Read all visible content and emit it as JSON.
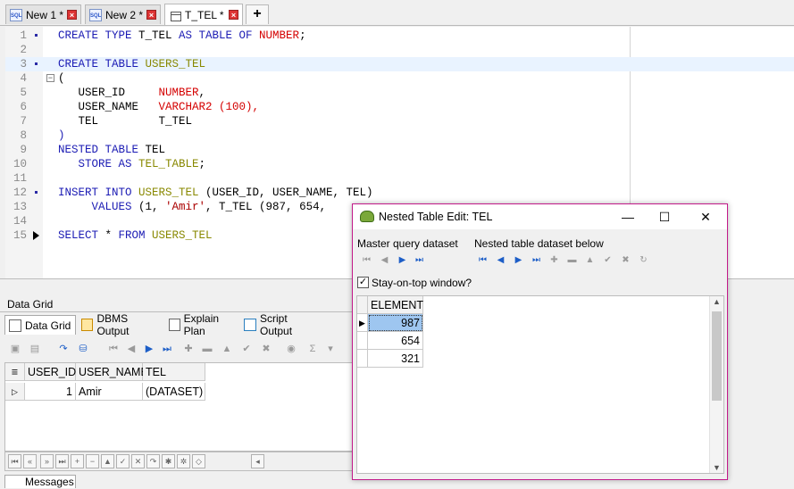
{
  "tabs": [
    {
      "label": "New 1 *"
    },
    {
      "label": "New 2 *"
    },
    {
      "label": "T_TEL *"
    }
  ],
  "tab_add": "+",
  "editor": {
    "lines": [
      {
        "num": "1"
      },
      {
        "num": "2"
      },
      {
        "num": "3"
      },
      {
        "num": "4"
      },
      {
        "num": "5"
      },
      {
        "num": "6"
      },
      {
        "num": "7"
      },
      {
        "num": "8"
      },
      {
        "num": "9"
      },
      {
        "num": "10"
      },
      {
        "num": "11"
      },
      {
        "num": "12"
      },
      {
        "num": "13"
      },
      {
        "num": "14"
      },
      {
        "num": "15"
      }
    ],
    "tokens": {
      "l1a": "CREATE TYPE",
      "l1b": " T_TEL ",
      "l1c": "AS TABLE OF",
      "l1d": " NUMBER",
      "l1e": ";",
      "l3a": "CREATE TABLE",
      "l3b": " USERS_TEL",
      "l4": "(",
      "l5a": "   USER_ID     ",
      "l5b": "NUMBER",
      "l5c": ",",
      "l6a": "   USER_NAME   ",
      "l6b": "VARCHAR2",
      "l6c": " (100),",
      "l7": "   TEL         T_TEL",
      "l8": ")",
      "l9a": "NESTED TABLE",
      "l9b": " TEL",
      "l10a": "   STORE AS",
      "l10b": " TEL_TABLE",
      "l10c": ";",
      "l12a": "INSERT INTO",
      "l12b": " USERS_TEL",
      "l12c": " (USER_ID, USER_NAME, TEL)",
      "l13a": "     VALUES",
      "l13b": " (1, ",
      "l13c": "'Amir'",
      "l13d": ", T_TEL (987, 654,",
      "l15a": "SELECT",
      "l15b": " * ",
      "l15c": "FROM",
      "l15d": " USERS_TEL"
    }
  },
  "bottom": {
    "header": "Data Grid",
    "tabs": [
      "Data Grid",
      "DBMS Output",
      "Explain Plan",
      "Script Output"
    ],
    "columns": [
      "USER_ID",
      "USER_NAME",
      "TEL"
    ],
    "rows": [
      {
        "user_id": "1",
        "user_name": "Amir",
        "tel": "(DATASET)"
      }
    ],
    "messages_tab": "Messages"
  },
  "dialog": {
    "title": "Nested Table Edit: TEL",
    "master_label": "Master query dataset",
    "nested_label": "Nested table dataset below",
    "stay_on_top": "Stay-on-top window?",
    "stay_on_top_checked": true,
    "column": "ELEMENT",
    "values": [
      "987",
      "654",
      "321"
    ]
  }
}
